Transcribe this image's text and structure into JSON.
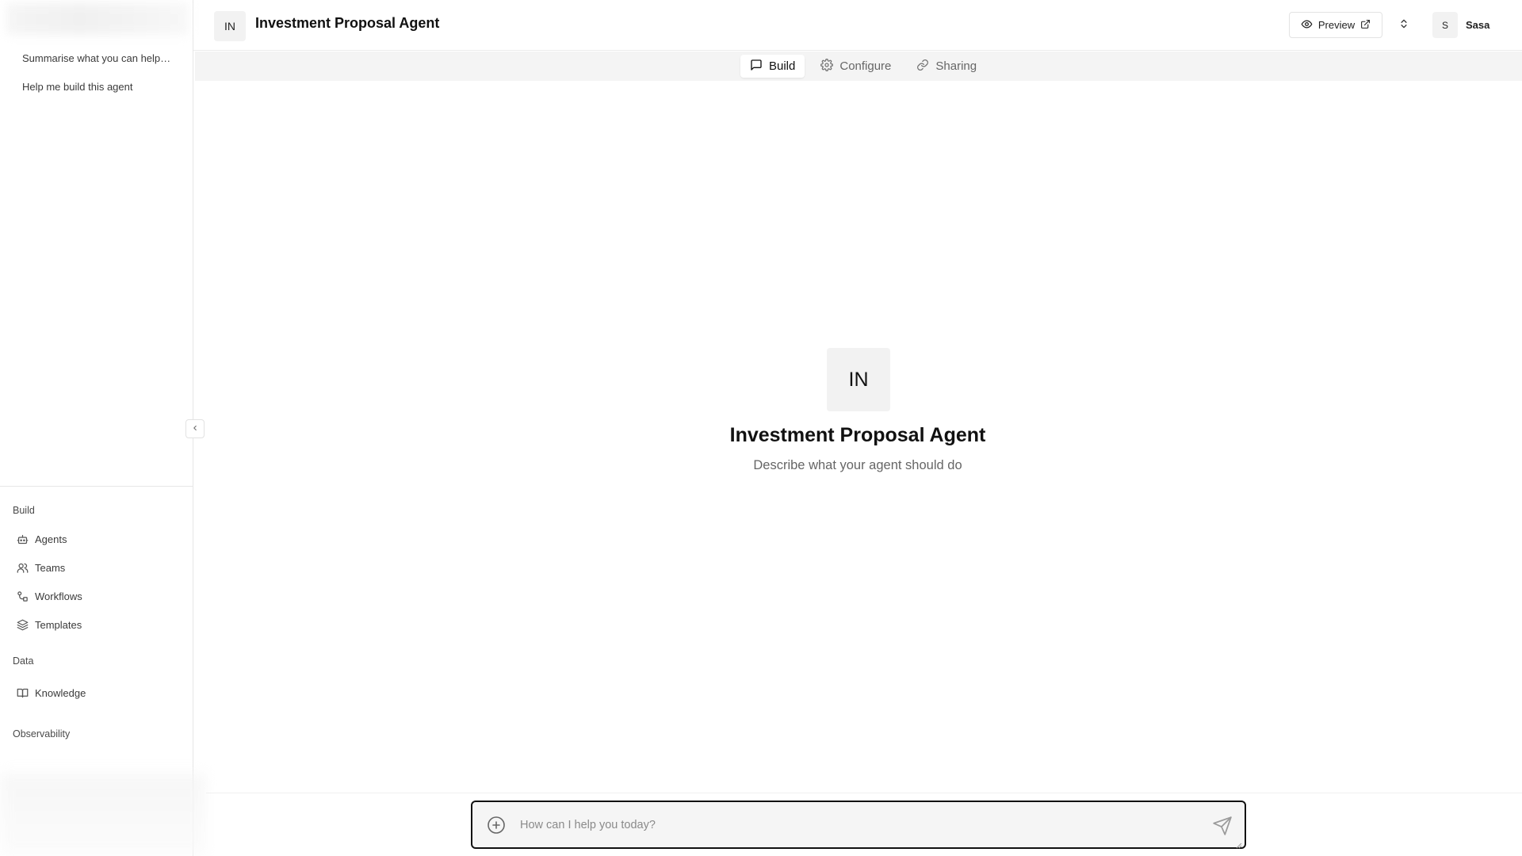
{
  "sidebar": {
    "history": [
      {
        "label": "Summarise what you can help ..."
      },
      {
        "label": "Help me build this agent"
      }
    ],
    "sections": {
      "build": {
        "title": "Build",
        "items": [
          {
            "label": "Agents",
            "icon": "robot-icon"
          },
          {
            "label": "Teams",
            "icon": "users-icon"
          },
          {
            "label": "Workflows",
            "icon": "workflow-icon"
          },
          {
            "label": "Templates",
            "icon": "layers-icon"
          }
        ]
      },
      "data": {
        "title": "Data",
        "items": [
          {
            "label": "Knowledge",
            "icon": "book-icon"
          }
        ]
      },
      "observability": {
        "title": "Observability"
      }
    }
  },
  "header": {
    "agent_initials": "IN",
    "agent_title": "Investment Proposal Agent",
    "preview_label": "Preview",
    "user_initial": "S",
    "user_name": "Sasa"
  },
  "tabs": [
    {
      "label": "Build",
      "icon": "message-square-icon",
      "active": true
    },
    {
      "label": "Configure",
      "icon": "gear-icon",
      "active": false
    },
    {
      "label": "Sharing",
      "icon": "link-icon",
      "active": false
    }
  ],
  "main": {
    "agent_initials": "IN",
    "title": "Investment Proposal Agent",
    "description": "Describe what your agent should do"
  },
  "composer": {
    "placeholder": "How can I help you today?",
    "value": ""
  },
  "colors": {
    "accent_border": "#111111",
    "muted_bg": "#f4f4f4"
  }
}
